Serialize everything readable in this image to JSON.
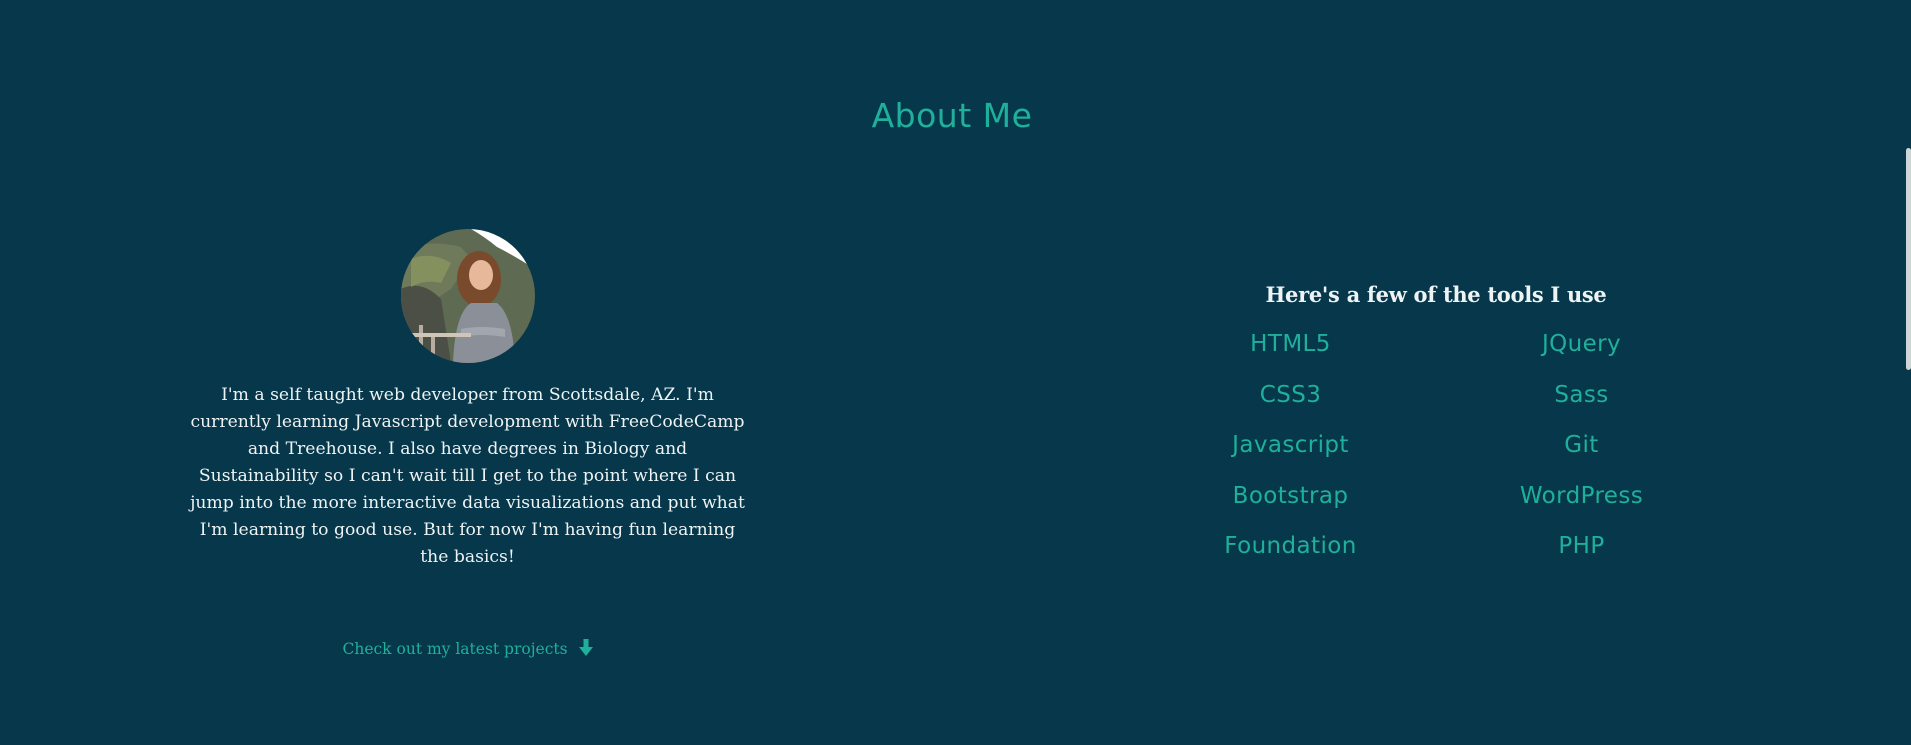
{
  "about": {
    "title": "About Me",
    "avatar_alt": "profile-photo",
    "bio": "I'm a self taught web developer from Scottsdale, AZ. I'm currently learning Javascript development with FreeCodeCamp and Treehouse. I also have degrees in Biology and Sustainability so I can't wait till I get to the point where I can jump into the more interactive data visualizations and put what I'm learning to good use. But for now I'm having fun learning the basics!",
    "projects_link": "Check out my latest projects",
    "projects_icon": "arrow-down-icon"
  },
  "tools": {
    "heading": "Here's a few of the tools I use",
    "items": [
      "HTML5",
      "JQuery",
      "CSS3",
      "Sass",
      "Javascript",
      "Git",
      "Bootstrap",
      "WordPress",
      "Foundation",
      "PHP"
    ]
  },
  "colors": {
    "background": "#07374a",
    "accent": "#1fb09c",
    "text": "#eef3f4"
  }
}
